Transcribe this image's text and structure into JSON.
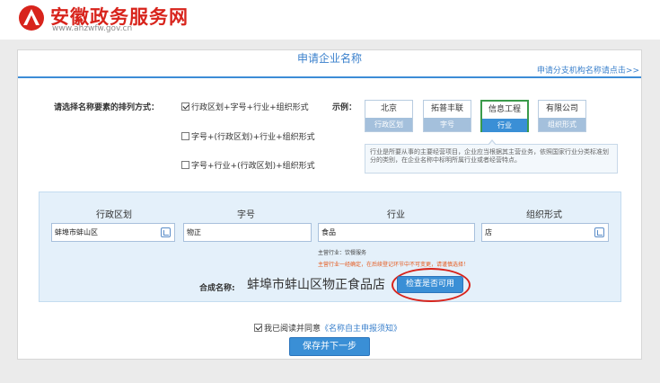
{
  "site": {
    "name": "安徽政务服务网",
    "url": "www.ahzwfw.gov.cn",
    "brand_color": "#d8241c"
  },
  "panel": {
    "title": "申请企业名称",
    "branch_link": "申请分支机构名称请点击>>"
  },
  "order": {
    "label": "请选择名称要素的排列方式：",
    "options": [
      {
        "label": "行政区划+字号+行业+组织形式",
        "checked": true
      },
      {
        "label": "字号+(行政区划)+行业+组织形式",
        "checked": false
      },
      {
        "label": "字号+行业+(行政区划)+组织形式",
        "checked": false
      }
    ]
  },
  "example": {
    "label": "示例：",
    "boxes": [
      {
        "value": "北京",
        "key": "行政区划",
        "active": false
      },
      {
        "value": "拓普丰联",
        "key": "字号",
        "active": false
      },
      {
        "value": "信息工程",
        "key": "行业",
        "active": true
      },
      {
        "value": "有限公司",
        "key": "组织形式",
        "active": false
      }
    ],
    "tip": "行业是所要从事的主要经营项目，企业应当根据其主营业务，依照国家行业分类标准划分的类别，在企业名称中标明所属行业或者经营特点。"
  },
  "form": {
    "headers": [
      "行政区划",
      "字号",
      "行业",
      "组织形式"
    ],
    "fields": {
      "region": "蚌埠市蚌山区",
      "trade_name": "物正",
      "industry": "食品",
      "org_form": "店"
    },
    "industry_note": "主营行业：饮餐服务",
    "industry_warning": "主营行业一经确定，在后续登记环节中不可变更，请谨慎选择！",
    "compose_label": "合成名称:",
    "composed_name": "蚌埠市蚌山区物正食品店",
    "check_button": "检查是否可用"
  },
  "agreement": {
    "prefix": "我已阅读并同意",
    "link": "《名称自主申报须知》",
    "checked": true
  },
  "submit_button": "保存并下一步",
  "colors": {
    "accent": "#3a8fd6",
    "warning": "#e65a1e",
    "highlight_circle": "#d8241c",
    "active_example": "#3a9a4a"
  }
}
